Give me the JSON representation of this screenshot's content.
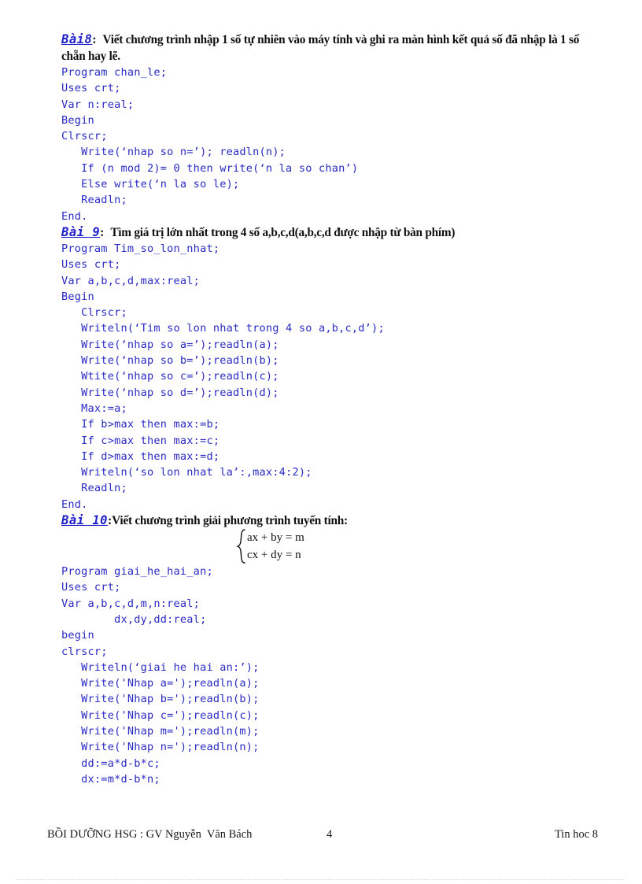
{
  "document": {
    "title": "Bài tập Pascal - Tin hoc 8",
    "code_color": "#2a2ac4",
    "heading_color": "#2222cc",
    "body_color": "#111111"
  },
  "exercises": [
    {
      "label": "Bài8",
      "colon": ":",
      "statement": "Viết chương trình nhập 1 số tự nhiên vào máy tính và ghi ra màn hình kết quả số đã nhập là 1 số chẵn hay lẽ.",
      "code": [
        "Program chan_le;",
        "Uses crt;",
        "Var n:real;",
        "Begin",
        "Clrscr;",
        "   Write(‘nhap so n=’); readln(n);",
        "   If (n mod 2)= 0 then write(‘n la so chan’)",
        "   Else write(‘n la so le);",
        "   Readln;",
        "End."
      ]
    },
    {
      "label": "Bài 9",
      "colon": ":",
      "statement": "Tìm giá trị lớn nhất trong 4 số a,b,c,d(a,b,c,d được nhập từ bàn phím)",
      "code": [
        "Program Tim_so_lon_nhat;",
        "Uses crt;",
        "Var a,b,c,d,max:real;",
        "Begin",
        "   Clrscr;",
        "   Writeln(‘Tim so lon nhat trong 4 so a,b,c,d’);",
        "   Write(‘nhap so a=’);readln(a);",
        "   Write(‘nhap so b=’);readln(b);",
        "   Wtite(‘nhap so c=’);readln(c);",
        "   Write(‘nhap so d=’);readln(d);",
        "   Max:=a;",
        "   If b>max then max:=b;",
        "   If c>max then max:=c;",
        "   If d>max then max:=d;",
        "   Writeln(‘so lon nhat la’:,max:4:2);",
        "   Readln;",
        "End."
      ]
    },
    {
      "label": "Bài 10",
      "colon": ":",
      "statement": "Viết chương trình giải phương trình tuyến tính:",
      "equations": [
        "ax + by = m",
        "cx + dy = n"
      ],
      "code": [
        "Program giai_he_hai_an;",
        "Uses crt;",
        "Var a,b,c,d,m,n:real;",
        "        dx,dy,dd:real;",
        "begin",
        "clrscr;",
        "   Writeln(‘giai he hai an:’);",
        "   Write('Nhap a=');readln(a);",
        "   Write('Nhap b=');readln(b);",
        "   Write('Nhap c=');readln(c);",
        "   Write('Nhap m=');readln(m);",
        "   Write('Nhap n=');readln(n);",
        "   dd:=a*d-b*c;",
        "   dx:=m*d-b*n;"
      ]
    }
  ],
  "footer": {
    "left": "BỒI DƯỠNG HSG : GV Nguyễn  Văn Bách",
    "page_number": "4",
    "right": "Tin hoc 8"
  }
}
